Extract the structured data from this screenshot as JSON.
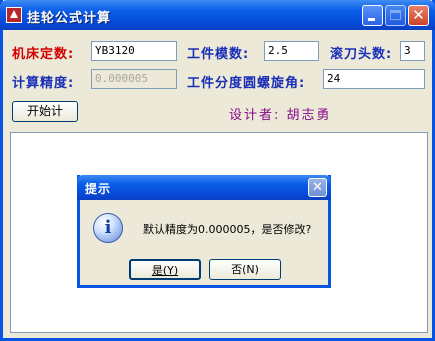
{
  "window": {
    "title": "挂轮公式计算"
  },
  "form": {
    "machine_label": "机床定数:",
    "machine_value": "YB3120",
    "module_label": "工件模数:",
    "module_value": "2.5",
    "hob_label": "滚刀头数:",
    "hob_value": "3",
    "precision_label": "计算精度:",
    "precision_value": "0.000005",
    "helix_label": "工件分度圆螺旋角:",
    "helix_value": "24",
    "start_button": "开始计",
    "designer": "设计者: 胡志勇"
  },
  "dialog": {
    "title": "提示",
    "message": "默认精度为0.000005，是否修改?",
    "yes_label": "是(Y)",
    "no_label": "否(N)"
  },
  "colors": {
    "titlebar": "#0a5ee8",
    "window_bg": "#ece9d8",
    "label_red": "#d40000",
    "label_blue": "#1a2fb8",
    "designer_purple": "#8a0a8a"
  },
  "icons": {
    "app": "app-triangle-icon",
    "info": "information-icon"
  }
}
